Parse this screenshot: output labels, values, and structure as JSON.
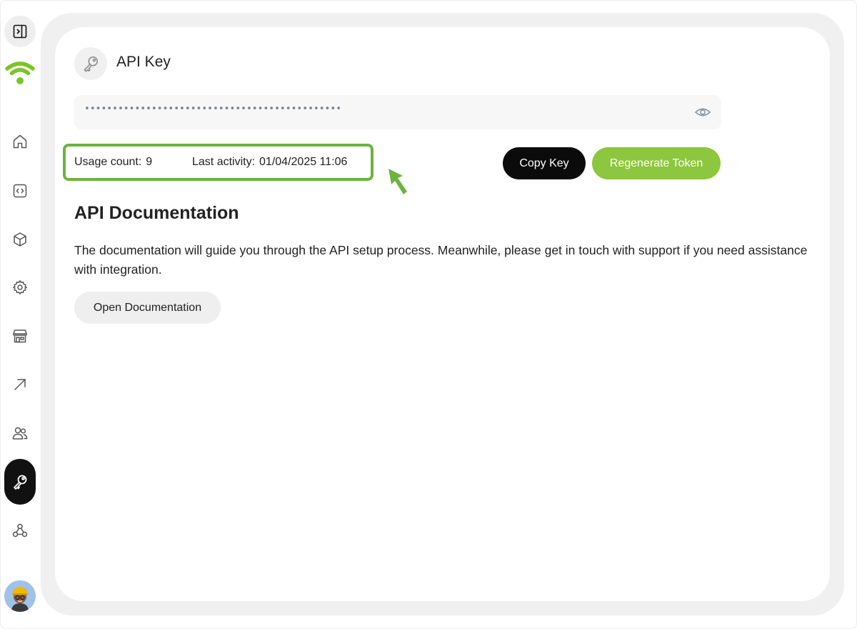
{
  "header": {
    "title": "API Key"
  },
  "api_key": {
    "masked_value": "••••••••••••••••••••••••••••••••••••••••••••••••••••••••••••••••••••••••••••••••••••"
  },
  "stats": {
    "usage_label": "Usage count:",
    "usage_value": "9",
    "activity_label": "Last activity:",
    "activity_value": "01/04/2025 11:06"
  },
  "actions": {
    "copy_label": "Copy Key",
    "regenerate_label": "Regenerate Token"
  },
  "documentation": {
    "title": "API Documentation",
    "description": "The documentation will guide you through the API setup process. Meanwhile, please get in touch with support if you need assistance with integration.",
    "button_label": "Open Documentation"
  },
  "sidebar": {
    "items": [
      {
        "icon": "panel-toggle-icon"
      },
      {
        "icon": "wifi-logo-icon"
      },
      {
        "icon": "home-icon"
      },
      {
        "icon": "code-icon"
      },
      {
        "icon": "cube-icon"
      },
      {
        "icon": "gear-icon"
      },
      {
        "icon": "store-icon"
      },
      {
        "icon": "arrow-up-right-icon"
      },
      {
        "icon": "users-icon"
      },
      {
        "icon": "key-icon",
        "active": true
      },
      {
        "icon": "webhook-icon"
      }
    ]
  },
  "colors": {
    "accent_green": "#8dc63f",
    "highlight_green": "#6db33f",
    "dark": "#0b0b0b"
  }
}
